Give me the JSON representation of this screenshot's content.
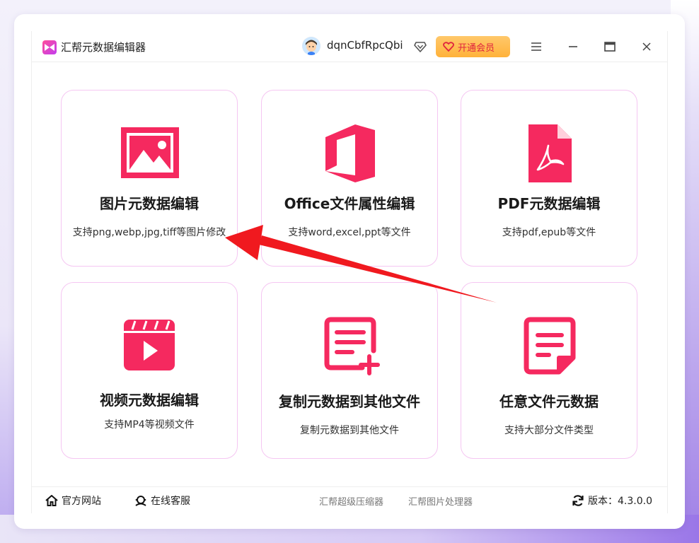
{
  "app": {
    "title": "汇帮元数据编辑器"
  },
  "user": {
    "name": "dqnCbfRpcQbi",
    "vip_button": "开通会员"
  },
  "icons": {
    "logo": "app-logo-icon",
    "avatar": "user-avatar-icon",
    "diamond": "diamond-icon",
    "menu": "hamburger-menu-icon",
    "minimize": "minimize-icon",
    "maximize": "maximize-icon",
    "close": "close-icon"
  },
  "cards": [
    {
      "title": "图片元数据编辑",
      "subtitle": "支持png,webp,jpg,tiff等图片修改",
      "icon": "image-icon"
    },
    {
      "title": "Office文件属性编辑",
      "subtitle": "支持word,excel,ppt等文件",
      "icon": "office-icon"
    },
    {
      "title": "PDF元数据编辑",
      "subtitle": "支持pdf,epub等文件",
      "icon": "pdf-icon"
    },
    {
      "title": "视频元数据编辑",
      "subtitle": "支持MP4等视频文件",
      "icon": "video-icon"
    },
    {
      "title": "复制元数据到其他文件",
      "subtitle": "复制元数据到其他文件",
      "icon": "copy-document-icon"
    },
    {
      "title": "任意文件元数据",
      "subtitle": "支持大部分文件类型",
      "icon": "file-icon"
    }
  ],
  "footer": {
    "website": "官方网站",
    "service": "在线客服",
    "link1": "汇帮超级压缩器",
    "link2": "汇帮图片处理器",
    "version": "版本：4.3.0.0"
  },
  "colors": {
    "accent": "#f5295f",
    "card_border": "#f5c6f2",
    "vip": "#ffb23a",
    "arrow": "#f0191f"
  }
}
